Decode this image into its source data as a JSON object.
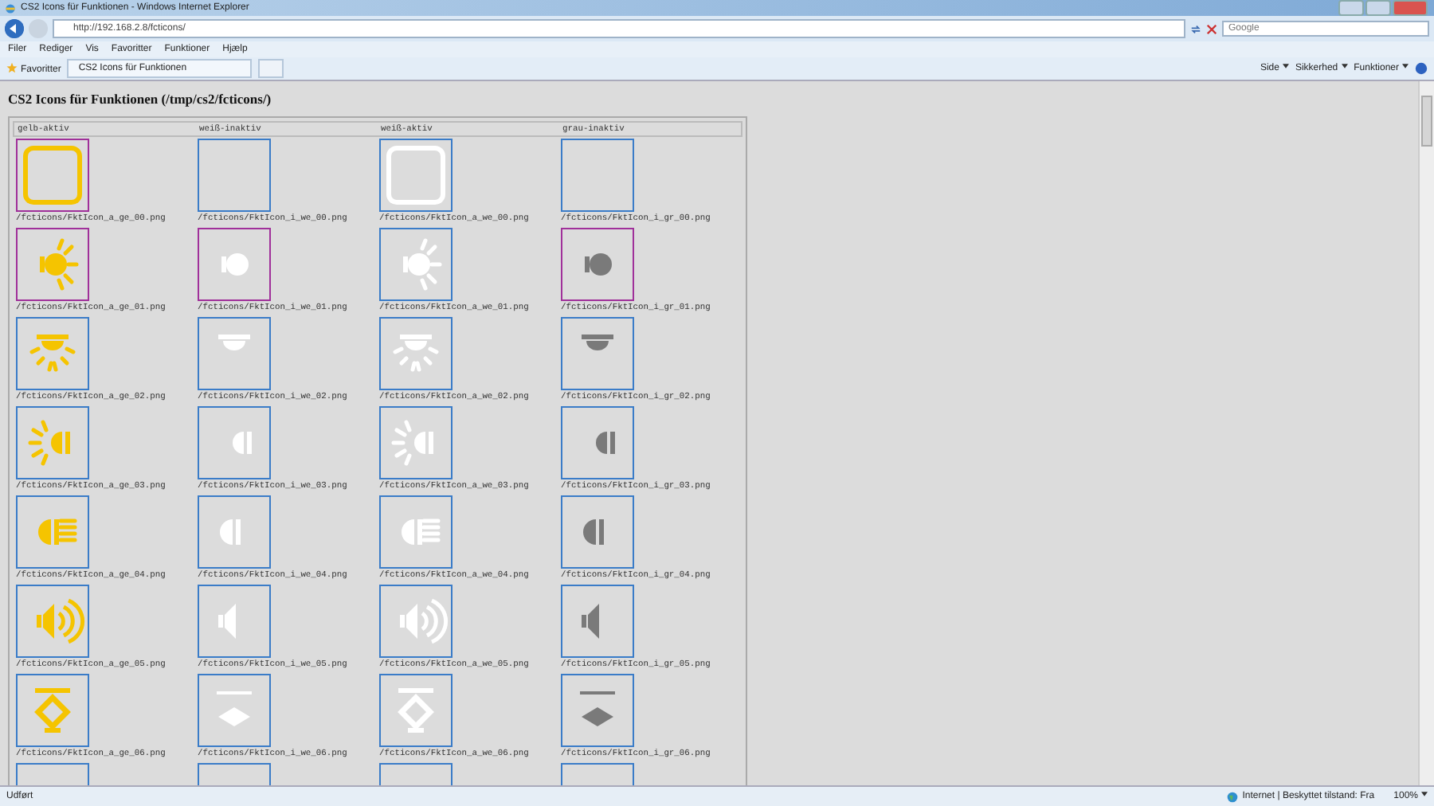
{
  "window": {
    "title": "CS2 Icons für Funktionen - Windows Internet Explorer"
  },
  "address_bar": {
    "url": "http://192.168.2.8/fcticons/",
    "search_placeholder": "Google"
  },
  "menu": [
    "Filer",
    "Rediger",
    "Vis",
    "Favoritter",
    "Funktioner",
    "Hjælp"
  ],
  "favorites_bar": {
    "favorites": "Favoritter",
    "tab": "CS2 Icons für Funktionen",
    "commands": [
      "Side",
      "Sikkerhed",
      "Funktioner"
    ]
  },
  "page": {
    "heading": "CS2 Icons für Funktionen (/tmp/cs2/fcticons/)",
    "columns": [
      "gelb-aktiv",
      "weiß-inaktiv",
      "weiß-aktiv",
      "grau-inaktiv"
    ],
    "rows": [
      {
        "kind": "frame",
        "cells": [
          {
            "file": "/fcticons/FktIcon_a_ge_00.png",
            "color": "#f5c400",
            "active": true,
            "highlighted": true
          },
          {
            "file": "/fcticons/FktIcon_i_we_00.png",
            "highlighted": false
          },
          {
            "file": "/fcticons/FktIcon_a_we_00.png",
            "color": "#ffffff",
            "active": true,
            "highlighted": false
          },
          {
            "file": "/fcticons/FktIcon_i_gr_00.png",
            "highlighted": false
          }
        ]
      },
      {
        "kind": "bulb",
        "cells": [
          {
            "file": "/fcticons/FktIcon_a_ge_01.png",
            "color": "#f5c400",
            "active": true,
            "highlighted": true
          },
          {
            "file": "/fcticons/FktIcon_i_we_01.png",
            "color": "#ffffff",
            "active": false,
            "highlighted": true
          },
          {
            "file": "/fcticons/FktIcon_a_we_01.png",
            "color": "#ffffff",
            "active": true,
            "highlighted": false
          },
          {
            "file": "/fcticons/FktIcon_i_gr_01.png",
            "color": "#7a7a7a",
            "active": false,
            "highlighted": true
          }
        ]
      },
      {
        "kind": "ceiling",
        "cells": [
          {
            "file": "/fcticons/FktIcon_a_ge_02.png",
            "color": "#f5c400",
            "active": true,
            "highlighted": false
          },
          {
            "file": "/fcticons/FktIcon_i_we_02.png",
            "color": "#ffffff",
            "active": false,
            "highlighted": false
          },
          {
            "file": "/fcticons/FktIcon_a_we_02.png",
            "color": "#ffffff",
            "active": true,
            "highlighted": false
          },
          {
            "file": "/fcticons/FktIcon_i_gr_02.png",
            "color": "#7a7a7a",
            "active": false,
            "highlighted": false
          }
        ]
      },
      {
        "kind": "side",
        "cells": [
          {
            "file": "/fcticons/FktIcon_a_ge_03.png",
            "color": "#f5c400",
            "active": true,
            "highlighted": false
          },
          {
            "file": "/fcticons/FktIcon_i_we_03.png",
            "color": "#ffffff",
            "active": false,
            "highlighted": false
          },
          {
            "file": "/fcticons/FktIcon_a_we_03.png",
            "color": "#ffffff",
            "active": true,
            "highlighted": false
          },
          {
            "file": "/fcticons/FktIcon_i_gr_03.png",
            "color": "#7a7a7a",
            "active": false,
            "highlighted": false
          }
        ]
      },
      {
        "kind": "headlight",
        "cells": [
          {
            "file": "/fcticons/FktIcon_a_ge_04.png",
            "color": "#f5c400",
            "active": true,
            "highlighted": false
          },
          {
            "file": "/fcticons/FktIcon_i_we_04.png",
            "color": "#ffffff",
            "active": false,
            "highlighted": false
          },
          {
            "file": "/fcticons/FktIcon_a_we_04.png",
            "color": "#ffffff",
            "active": true,
            "highlighted": false
          },
          {
            "file": "/fcticons/FktIcon_i_gr_04.png",
            "color": "#7a7a7a",
            "active": false,
            "highlighted": false
          }
        ]
      },
      {
        "kind": "speaker",
        "cells": [
          {
            "file": "/fcticons/FktIcon_a_ge_05.png",
            "color": "#f5c400",
            "active": true,
            "highlighted": false
          },
          {
            "file": "/fcticons/FktIcon_i_we_05.png",
            "color": "#ffffff",
            "active": false,
            "highlighted": false
          },
          {
            "file": "/fcticons/FktIcon_a_we_05.png",
            "color": "#ffffff",
            "active": true,
            "highlighted": false
          },
          {
            "file": "/fcticons/FktIcon_i_gr_05.png",
            "color": "#7a7a7a",
            "active": false,
            "highlighted": false
          }
        ]
      },
      {
        "kind": "hanger",
        "cells": [
          {
            "file": "/fcticons/FktIcon_a_ge_06.png",
            "color": "#f5c400",
            "active": true,
            "highlighted": false
          },
          {
            "file": "/fcticons/FktIcon_i_we_06.png",
            "color": "#ffffff",
            "active": false,
            "highlighted": false
          },
          {
            "file": "/fcticons/FktIcon_a_we_06.png",
            "color": "#ffffff",
            "active": true,
            "highlighted": false
          },
          {
            "file": "/fcticons/FktIcon_i_gr_06.png",
            "color": "#7a7a7a",
            "active": false,
            "highlighted": false
          }
        ]
      },
      {
        "cells": [
          {
            "highlighted": false
          },
          {
            "highlighted": false
          },
          {
            "highlighted": false
          },
          {
            "highlighted": false
          }
        ]
      }
    ]
  },
  "status_bar": {
    "text": "Udført",
    "zone": "Internet | Beskyttet tilstand: Fra",
    "zoom": "100%"
  }
}
